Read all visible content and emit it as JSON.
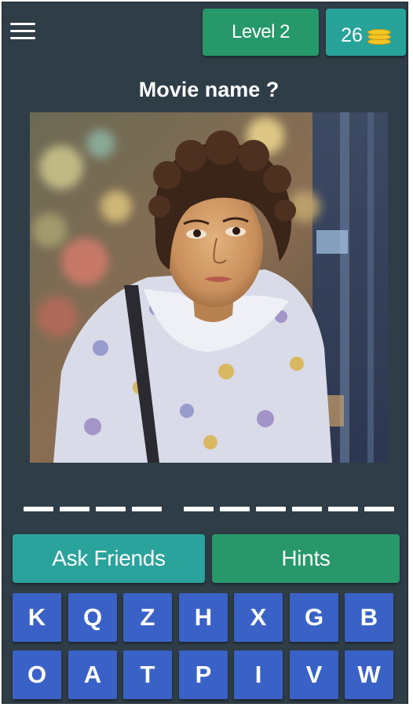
{
  "header": {
    "menu_icon": "hamburger-menu-icon",
    "level_label": "Level 2",
    "coins": "26",
    "coins_icon": "coin-stack-icon"
  },
  "question": "Movie name ?",
  "answer": {
    "word_lengths": [
      4,
      6
    ]
  },
  "actions": {
    "ask_friends": "Ask Friends",
    "hints": "Hints"
  },
  "keyboard": {
    "row1": [
      "K",
      "Q",
      "Z",
      "H",
      "X",
      "G",
      "B"
    ],
    "row2": [
      "O",
      "A",
      "T",
      "P",
      "I",
      "V",
      "W"
    ]
  },
  "colors": {
    "background": "#2f3d47",
    "level_badge": "#27986a",
    "coin_badge": "#28a39a",
    "ask_button": "#29a39b",
    "hints_button": "#28986a",
    "key": "#3a62c6",
    "coin": "#f3c623"
  }
}
